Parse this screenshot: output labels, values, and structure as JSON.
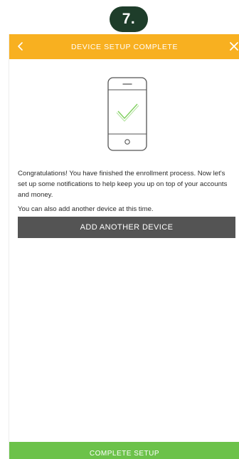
{
  "step_badge": "7.",
  "header": {
    "title": "DEVICE SETUP COMPLETE",
    "back_icon": "chevron-left-icon",
    "close_icon": "close-icon"
  },
  "illustration": {
    "icon": "phone-checkmark-icon"
  },
  "message": {
    "paragraph_1": "Congratulations! You have finished the enrollment process. Now let's set up some notifications to help keep you up on top of your accounts and money.",
    "paragraph_2": "You can also add another device at this time."
  },
  "buttons": {
    "add_device": "ADD ANOTHER DEVICE",
    "complete_setup": "COMPLETE SETUP"
  },
  "colors": {
    "header": "#f8b020",
    "primary_button": "#545454",
    "footer_button": "#6cc24a",
    "check": "#7fcf5e",
    "badge": "#1e3d2a"
  }
}
